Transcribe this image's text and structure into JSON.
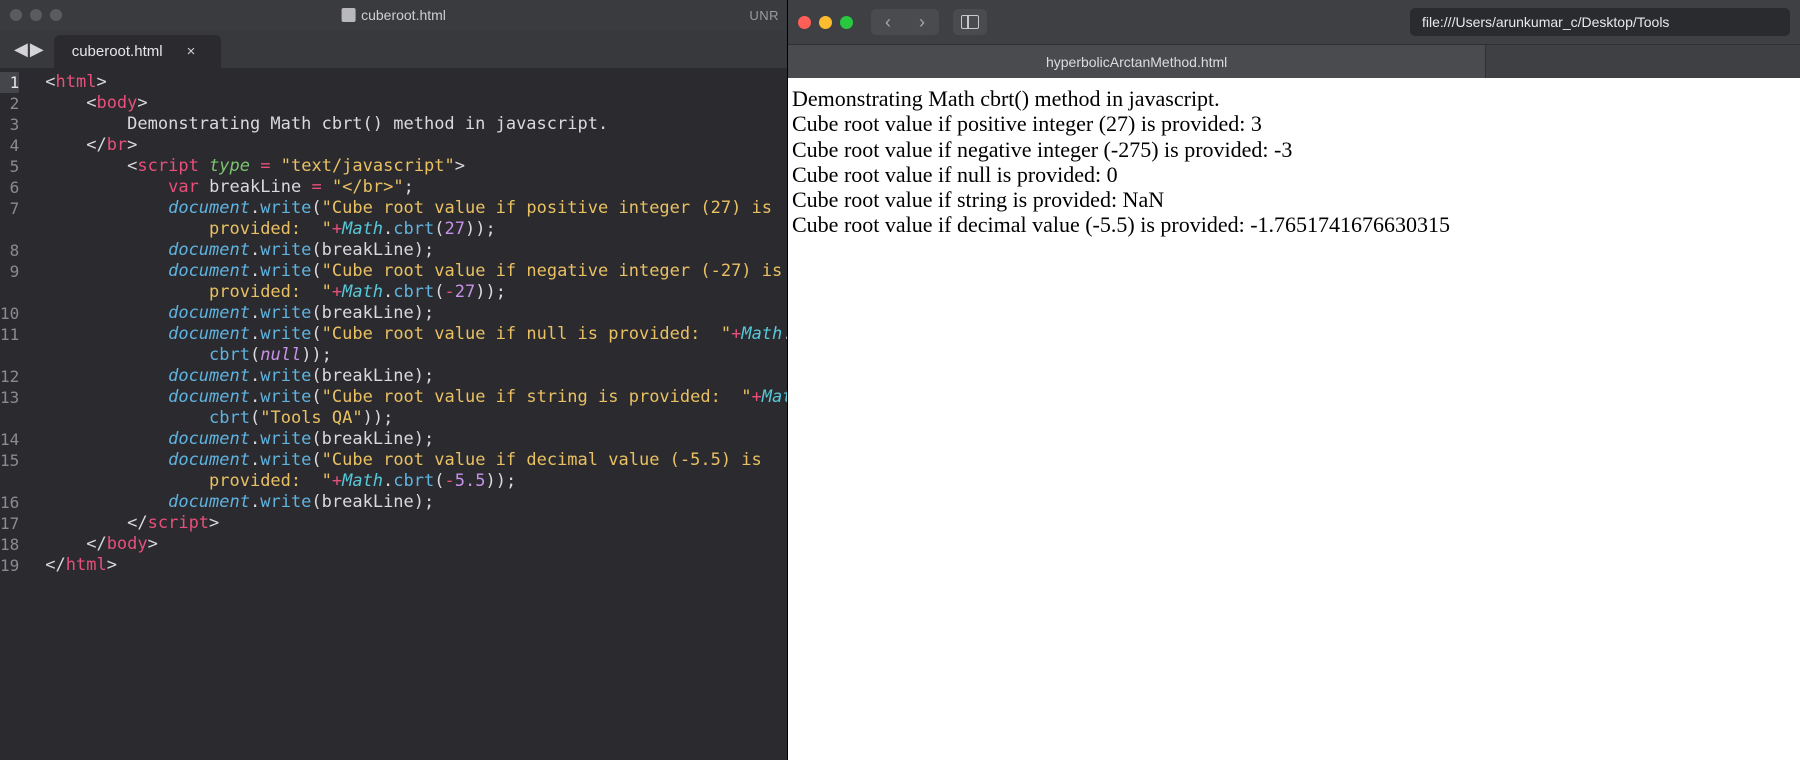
{
  "editor": {
    "window_title": "cuberoot.html",
    "unsaved_indicator": "UNR",
    "tab": {
      "label": "cuberoot.html"
    },
    "line_numbers": [
      "1",
      "2",
      "3",
      "4",
      "5",
      "6",
      "7",
      "",
      "8",
      "9",
      "",
      "10",
      "11",
      "",
      "12",
      "13",
      "",
      "14",
      "15",
      "",
      "16",
      "17",
      "18",
      "19"
    ],
    "code_tokens": [
      [
        [
          "p",
          "<"
        ],
        [
          "tg",
          "html"
        ],
        [
          "p",
          ">"
        ]
      ],
      [
        [
          "p",
          "    <"
        ],
        [
          "tg",
          "body"
        ],
        [
          "p",
          ">"
        ]
      ],
      [
        [
          "tx",
          "        Demonstrating Math cbrt() method in javascript."
        ]
      ],
      [
        [
          "p",
          "    </"
        ],
        [
          "tg",
          "br"
        ],
        [
          "p",
          ">"
        ]
      ],
      [
        [
          "p",
          "        <"
        ],
        [
          "tg",
          "script"
        ],
        [
          "p",
          " "
        ],
        [
          "at",
          "type"
        ],
        [
          "p",
          " "
        ],
        [
          "op",
          "="
        ],
        [
          "p",
          " "
        ],
        [
          "st",
          "\"text/javascript\""
        ],
        [
          "p",
          ">"
        ]
      ],
      [
        [
          "p",
          "            "
        ],
        [
          "kw",
          "var"
        ],
        [
          "p",
          " "
        ],
        [
          "va",
          "breakLine"
        ],
        [
          "p",
          " "
        ],
        [
          "op",
          "="
        ],
        [
          "p",
          " "
        ],
        [
          "st",
          "\"</br>\""
        ],
        [
          "p",
          ";"
        ]
      ],
      [
        [
          "p",
          "            "
        ],
        [
          "id",
          "document"
        ],
        [
          "p",
          "."
        ],
        [
          "fn",
          "write"
        ],
        [
          "p",
          "("
        ],
        [
          "st",
          "\"Cube root value if positive integer (27) is "
        ]
      ],
      [
        [
          "st",
          "                provided:  \""
        ],
        [
          "op",
          "+"
        ],
        [
          "cl",
          "Math"
        ],
        [
          "p",
          "."
        ],
        [
          "fn",
          "cbrt"
        ],
        [
          "p",
          "("
        ],
        [
          "nu",
          "27"
        ],
        [
          "p",
          "));"
        ]
      ],
      [
        [
          "p",
          "            "
        ],
        [
          "id",
          "document"
        ],
        [
          "p",
          "."
        ],
        [
          "fn",
          "write"
        ],
        [
          "p",
          "(breakLine);"
        ]
      ],
      [
        [
          "p",
          "            "
        ],
        [
          "id",
          "document"
        ],
        [
          "p",
          "."
        ],
        [
          "fn",
          "write"
        ],
        [
          "p",
          "("
        ],
        [
          "st",
          "\"Cube root value if negative integer (-27) is "
        ]
      ],
      [
        [
          "st",
          "                provided:  \""
        ],
        [
          "op",
          "+"
        ],
        [
          "cl",
          "Math"
        ],
        [
          "p",
          "."
        ],
        [
          "fn",
          "cbrt"
        ],
        [
          "p",
          "("
        ],
        [
          "op",
          "-"
        ],
        [
          "nu",
          "27"
        ],
        [
          "p",
          "));"
        ]
      ],
      [
        [
          "p",
          "            "
        ],
        [
          "id",
          "document"
        ],
        [
          "p",
          "."
        ],
        [
          "fn",
          "write"
        ],
        [
          "p",
          "(breakLine);"
        ]
      ],
      [
        [
          "p",
          "            "
        ],
        [
          "id",
          "document"
        ],
        [
          "p",
          "."
        ],
        [
          "fn",
          "write"
        ],
        [
          "p",
          "("
        ],
        [
          "st",
          "\"Cube root value if null is provided:  \""
        ],
        [
          "op",
          "+"
        ],
        [
          "cl",
          "Math"
        ],
        [
          "p",
          "."
        ]
      ],
      [
        [
          "p",
          "                "
        ],
        [
          "fn",
          "cbrt"
        ],
        [
          "p",
          "("
        ],
        [
          "nl",
          "null"
        ],
        [
          "p",
          "));"
        ]
      ],
      [
        [
          "p",
          "            "
        ],
        [
          "id",
          "document"
        ],
        [
          "p",
          "."
        ],
        [
          "fn",
          "write"
        ],
        [
          "p",
          "(breakLine);"
        ]
      ],
      [
        [
          "p",
          "            "
        ],
        [
          "id",
          "document"
        ],
        [
          "p",
          "."
        ],
        [
          "fn",
          "write"
        ],
        [
          "p",
          "("
        ],
        [
          "st",
          "\"Cube root value if string is provided:  \""
        ],
        [
          "op",
          "+"
        ],
        [
          "cl",
          "Math"
        ],
        [
          "p",
          "."
        ]
      ],
      [
        [
          "p",
          "                "
        ],
        [
          "fn",
          "cbrt"
        ],
        [
          "p",
          "("
        ],
        [
          "st",
          "\"Tools QA\""
        ],
        [
          "p",
          "));"
        ]
      ],
      [
        [
          "p",
          "            "
        ],
        [
          "id",
          "document"
        ],
        [
          "p",
          "."
        ],
        [
          "fn",
          "write"
        ],
        [
          "p",
          "(breakLine);"
        ]
      ],
      [
        [
          "p",
          "            "
        ],
        [
          "id",
          "document"
        ],
        [
          "p",
          "."
        ],
        [
          "fn",
          "write"
        ],
        [
          "p",
          "("
        ],
        [
          "st",
          "\"Cube root value if decimal value (-5.5) is "
        ]
      ],
      [
        [
          "st",
          "                provided:  \""
        ],
        [
          "op",
          "+"
        ],
        [
          "cl",
          "Math"
        ],
        [
          "p",
          "."
        ],
        [
          "fn",
          "cbrt"
        ],
        [
          "p",
          "("
        ],
        [
          "op",
          "-"
        ],
        [
          "nu",
          "5.5"
        ],
        [
          "p",
          "));"
        ]
      ],
      [
        [
          "p",
          "            "
        ],
        [
          "id",
          "document"
        ],
        [
          "p",
          "."
        ],
        [
          "fn",
          "write"
        ],
        [
          "p",
          "(breakLine);"
        ]
      ],
      [
        [
          "p",
          "        </"
        ],
        [
          "tg",
          "script"
        ],
        [
          "p",
          ">"
        ]
      ],
      [
        [
          "p",
          "    </"
        ],
        [
          "tg",
          "body"
        ],
        [
          "p",
          ">"
        ]
      ],
      [
        [
          "p",
          "</"
        ],
        [
          "tg",
          "html"
        ],
        [
          "p",
          ">"
        ]
      ]
    ]
  },
  "browser": {
    "url": "file:///Users/arunkumar_c/Desktop/Tools",
    "tab_title": "hyperbolicArctanMethod.html",
    "output_lines": [
      "Demonstrating Math cbrt() method in javascript.",
      "Cube root value if positive integer (27) is provided: 3",
      "Cube root value if negative integer (-275) is provided: -3",
      "Cube root value if null is provided: 0",
      "Cube root value if string is provided: NaN",
      "Cube root value if decimal value (-5.5) is provided: -1.7651741676630315"
    ]
  }
}
